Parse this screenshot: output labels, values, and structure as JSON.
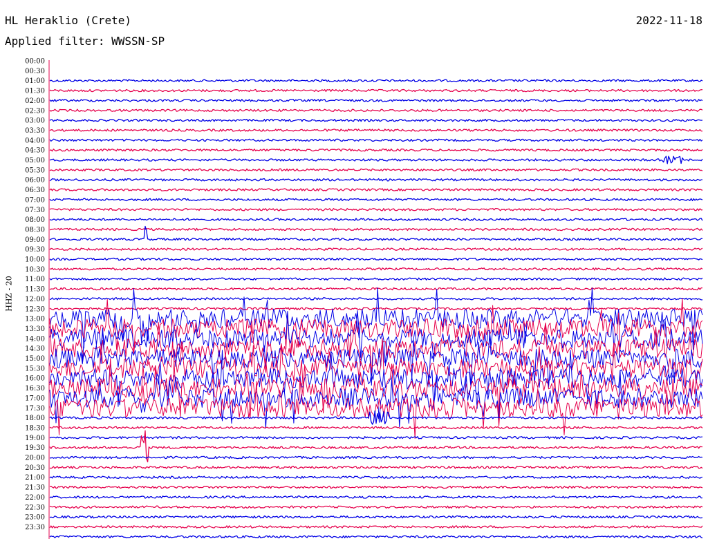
{
  "header": {
    "station": "HL Heraklio (Crete)",
    "date": "2022-11-18",
    "filter_text": "Applied filter: WWSSN-SP"
  },
  "chart_data": {
    "type": "line",
    "title": "HL Heraklio (Crete)",
    "ylabel": "HHZ - 20",
    "categories": [
      "00:00",
      "00:30",
      "01:00",
      "01:30",
      "02:00",
      "02:30",
      "03:00",
      "03:30",
      "04:00",
      "04:30",
      "05:00",
      "05:30",
      "06:00",
      "06:30",
      "07:00",
      "07:30",
      "08:00",
      "08:30",
      "09:00",
      "09:30",
      "10:00",
      "10:30",
      "11:00",
      "11:30",
      "12:00",
      "12:30",
      "13:00",
      "13:30",
      "14:00",
      "14:30",
      "15:00",
      "15:30",
      "16:00",
      "16:30",
      "17:00",
      "17:30",
      "18:00",
      "18:30",
      "19:00",
      "19:30",
      "20:00",
      "20:30",
      "21:00",
      "21:30",
      "22:00",
      "22:30",
      "23:00",
      "23:30"
    ],
    "trace_colors": [
      "#0000e6",
      "#e6004c"
    ],
    "axis_color": "#e6004c",
    "first_trace_row": "01:00",
    "noisy_rows": [
      "13:00",
      "13:30",
      "14:00",
      "14:30",
      "15:00",
      "15:30",
      "16:00",
      "16:30",
      "17:00",
      "17:30"
    ],
    "events": [
      {
        "row": "05:00",
        "start": 0.94,
        "end": 0.97,
        "amplitude": 0.4
      },
      {
        "row": "18:00",
        "start": 0.49,
        "end": 0.52,
        "amplitude": 0.7
      },
      {
        "row": "09:00",
        "start": 0.145,
        "end": 0.15,
        "amplitude": 2.0
      },
      {
        "row": "19:30",
        "start": 0.14,
        "end": 0.15,
        "amplitude": 2.0
      }
    ]
  }
}
